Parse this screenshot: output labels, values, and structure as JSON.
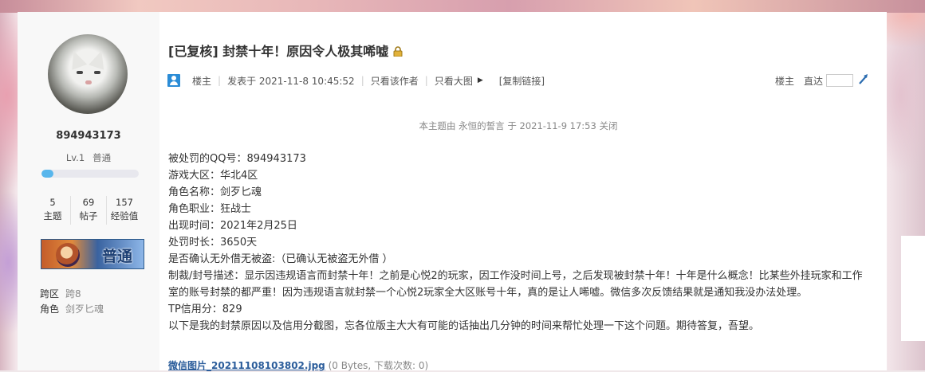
{
  "author": {
    "username": "894943173",
    "level": "Lv.1",
    "group": "普通",
    "level_progress": 0.12,
    "stats": [
      {
        "value": "5",
        "label": "主题"
      },
      {
        "value": "69",
        "label": "帖子"
      },
      {
        "value": "157",
        "label": "经验值"
      }
    ],
    "badge_text": "普通",
    "profile": [
      {
        "key": "跨区",
        "value": "跨8"
      },
      {
        "key": "角色",
        "value": "剑歹匕魂"
      }
    ]
  },
  "thread": {
    "title": "[已复核] 封禁十年！原因令人极其唏嘘",
    "meta": {
      "poster": "楼主",
      "posted_at": "发表于 2021-11-8 10:45:52",
      "only_author": "只看该作者",
      "large_images": "只看大图",
      "copy_link": "[复制链接]",
      "floor": "楼主",
      "goto_label": "直达"
    },
    "notice": "本主题由 永恒的誓言 于 2021-11-9 17:53 关闭",
    "body_lines": [
      "被处罚的QQ号：894943173",
      "游戏大区：华北4区",
      "角色名称：剑歹匕魂",
      "角色职业：狂战士",
      "出现时间：2021年2月25日",
      "处罚时长：3650天",
      "是否确认无外借无被盗:（已确认无被盗无外借 ）",
      "制裁/封号描述：显示因违规语言而封禁十年！之前是心悦2的玩家，因工作没时间上号，之后发现被封禁十年！十年是什么概念！比某些外挂玩家和工作室的账号封禁的都严重！因为违规语言就封禁一个心悦2玩家全大区账号十年，真的是让人唏嘘。微信多次反馈结果就是通知我没办法处理。",
      "TP信用分：829",
      "以下是我的封禁原因以及信用分截图，忘各位版主大大有可能的话抽出几分钟的时间来帮忙处理一下这个问题。期待答复，吾望。"
    ],
    "attachment": {
      "name": "微信图片_20211108103802.jpg",
      "info": "(0 Bytes, 下载次数: 0)"
    }
  },
  "colors": {
    "accent": "#2b8cd6",
    "level_bar": "#58b6ec",
    "link": "#2b5d9b"
  }
}
